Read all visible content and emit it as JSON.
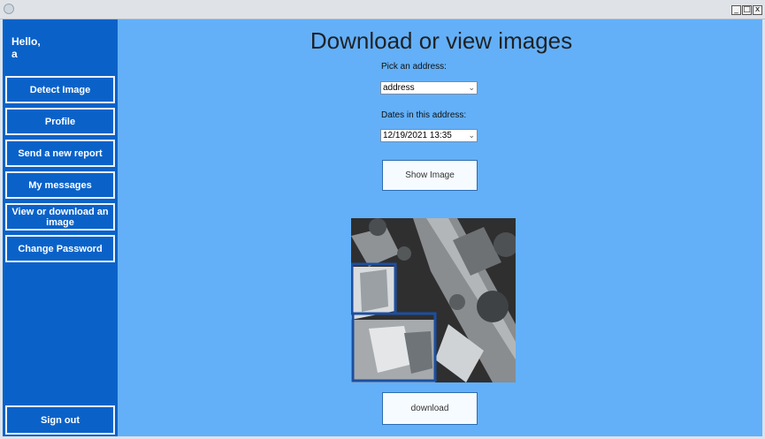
{
  "greeting": {
    "hello": "Hello,",
    "user": "a"
  },
  "sidebar": {
    "items": [
      {
        "label": "Detect Image"
      },
      {
        "label": "Profile"
      },
      {
        "label": "Send a new report"
      },
      {
        "label": "My messages"
      },
      {
        "label": "View or download an image"
      },
      {
        "label": "Change Password"
      }
    ],
    "signout": "Sign out"
  },
  "main": {
    "title": "Download or view images",
    "address_label": "Pick an address:",
    "address_value": "address",
    "dates_label": "Dates in this address:",
    "date_value": "12/19/2021 13:35",
    "show_button": "Show Image",
    "download_button": "download"
  },
  "window": {
    "min": "_",
    "max": "□",
    "close": "x"
  },
  "colors": {
    "sidebar": "#0a62c9",
    "main_bg": "#63b0f8",
    "box": "#1c4fa0"
  },
  "icons": [
    "app-icon",
    "minimize-icon",
    "maximize-icon",
    "close-icon",
    "chevron-down-icon"
  ]
}
